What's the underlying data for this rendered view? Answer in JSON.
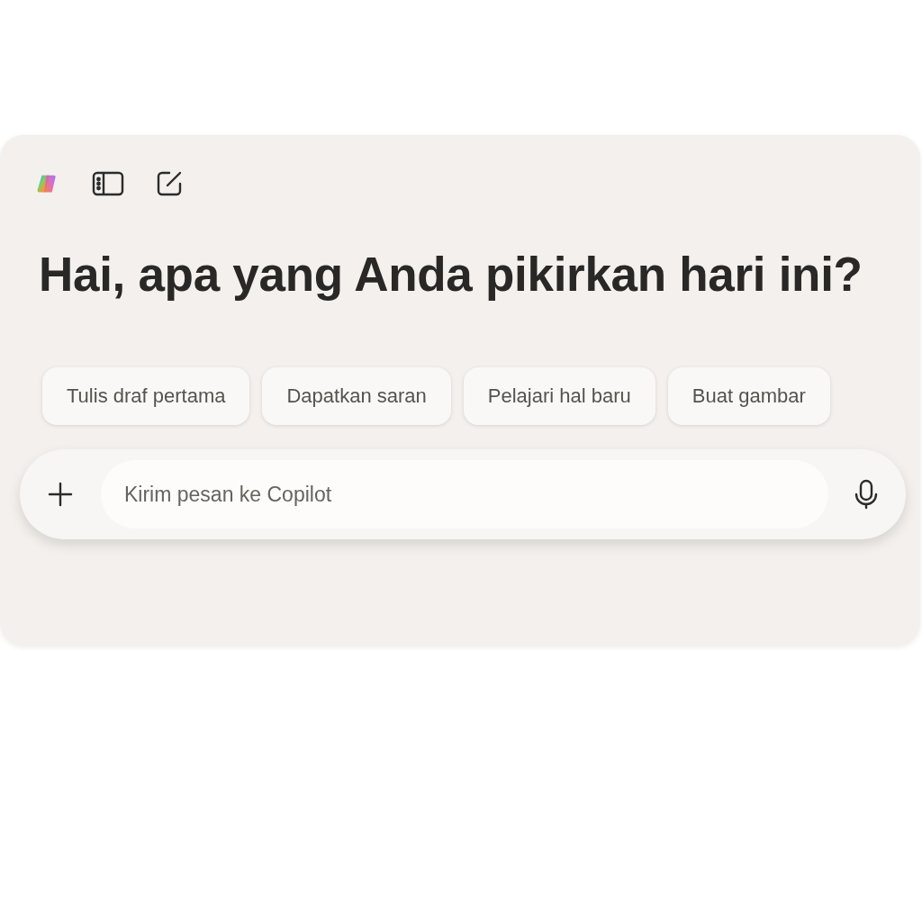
{
  "heading": "Hai, apa yang Anda pikirkan hari ini?",
  "suggestions": [
    "Tulis draf pertama",
    "Dapatkan saran",
    "Pelajari hal baru",
    "Buat gambar"
  ],
  "composer": {
    "placeholder": "Kirim pesan ke Copilot"
  }
}
